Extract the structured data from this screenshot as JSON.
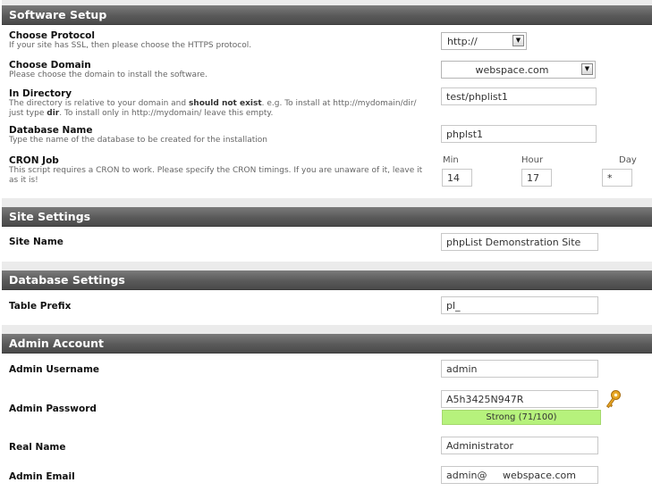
{
  "software_setup": {
    "title": "Software Setup",
    "protocol": {
      "label": "Choose Protocol",
      "desc": "If your site has SSL, then please choose the HTTPS protocol.",
      "value": "http://"
    },
    "domain": {
      "label": "Choose Domain",
      "desc": "Please choose the domain to install the software.",
      "value": "webspace.com"
    },
    "directory": {
      "label": "In Directory",
      "desc_pre": "The directory is relative to your domain and ",
      "desc_bold1": "should not exist",
      "desc_mid": ". e.g. To install at http://mydomain/dir/ just type ",
      "desc_bold2": "dir",
      "desc_post": ". To install only in http://mydomain/ leave this empty.",
      "value": "test/phplist1"
    },
    "database": {
      "label": "Database Name",
      "desc": "Type the name of the database to be created for the installation",
      "value": "phplst1"
    },
    "cron": {
      "label": "CRON Job",
      "desc": "This script requires a CRON to work. Please specify the CRON timings. If you are unaware of it, leave it as it is!",
      "min_label": "Min",
      "hour_label": "Hour",
      "day_label": "Day",
      "min": "14",
      "hour": "17",
      "day": "*"
    }
  },
  "site_settings": {
    "title": "Site Settings",
    "site_name": {
      "label": "Site Name",
      "value": "phpList Demonstration Site"
    }
  },
  "database_settings": {
    "title": "Database Settings",
    "table_prefix": {
      "label": "Table Prefix",
      "value": "pl_"
    }
  },
  "admin_account": {
    "title": "Admin Account",
    "username": {
      "label": "Admin Username",
      "value": "admin"
    },
    "password": {
      "label": "Admin Password",
      "value": "A5h3425N947R",
      "strength": "Strong (71/100)"
    },
    "real_name": {
      "label": "Real Name",
      "value": "Administrator"
    },
    "email": {
      "label": "Admin Email",
      "value": "admin@     webspace.com"
    }
  },
  "colors": {
    "header": "#5f5f5f",
    "strength_bg": "#b6f27c",
    "key_icon": "#e0a020"
  },
  "icons": {
    "generate_password": "key-icon",
    "dropdown": "chevron-down-icon"
  }
}
